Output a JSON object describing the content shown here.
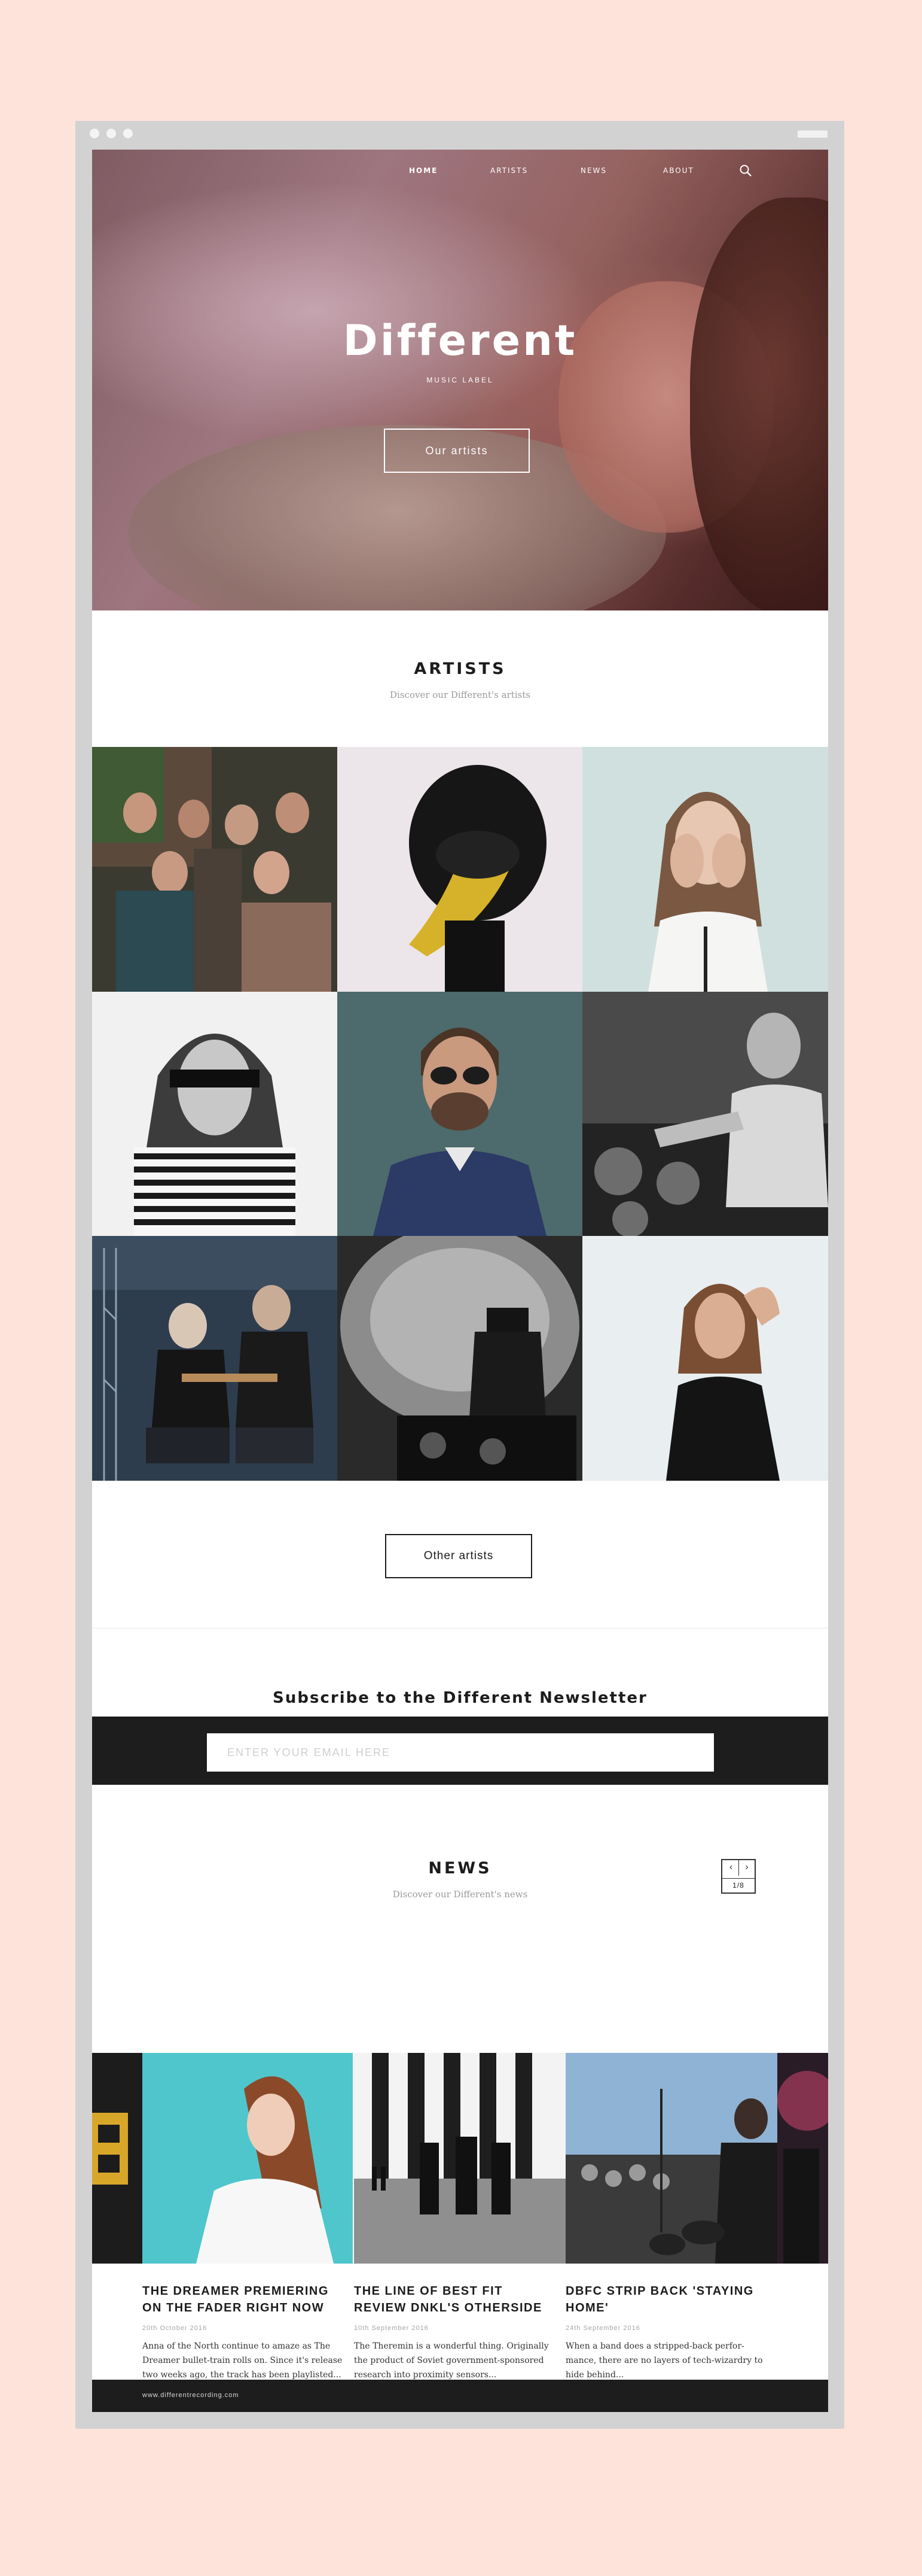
{
  "nav": {
    "items": [
      "HOME",
      "ARTISTS",
      "NEWS",
      "ABOUT"
    ],
    "search_icon": "search-icon"
  },
  "hero": {
    "title": "Different",
    "subtitle": "MUSIC LABEL",
    "cta": "Our artists"
  },
  "artists": {
    "title": "ARTISTS",
    "subtitle": "Discover our Different's artists",
    "more_button": "Other artists"
  },
  "newsletter": {
    "title": "Subscribe to the Different Newsletter",
    "placeholder": "ENTER YOUR EMAIL HERE"
  },
  "news": {
    "title": "NEWS",
    "subtitle": "Discover our Different's news",
    "pager": {
      "prev": "‹",
      "next": "›",
      "count": "1/8"
    },
    "items": [
      {
        "title": "THE DREAMER PREMIERING ON THE FADER RIGHT NOW",
        "date": "20th October 2016",
        "text": "Anna of the North continue to amaze as The Dreamer bullet-train rolls on. Since it's release two weeks ago, the track has been playlisted...",
        "more": "•••"
      },
      {
        "title": "THE LINE OF BEST FIT REVIEW DNKL'S OTHERSIDE",
        "date": "10th September 2016",
        "text": "The Theremin is a wonderful thing. Originally the product of Soviet government-sponsored research into proximity sensors...",
        "more": "•••"
      },
      {
        "title": "DBFC STRIP BACK 'STAYING HOME'",
        "date": "24th September 2016",
        "text": "When a band does a stripped-back perfor- mance, there are no layers of tech-wizardry to hide behind...",
        "more": "•••"
      }
    ]
  },
  "footer": {
    "url": "www.differentrecording.com"
  },
  "colors": {
    "background": "#fde3d9",
    "frame": "#d2d2d2",
    "dark": "#1d1d1d"
  }
}
